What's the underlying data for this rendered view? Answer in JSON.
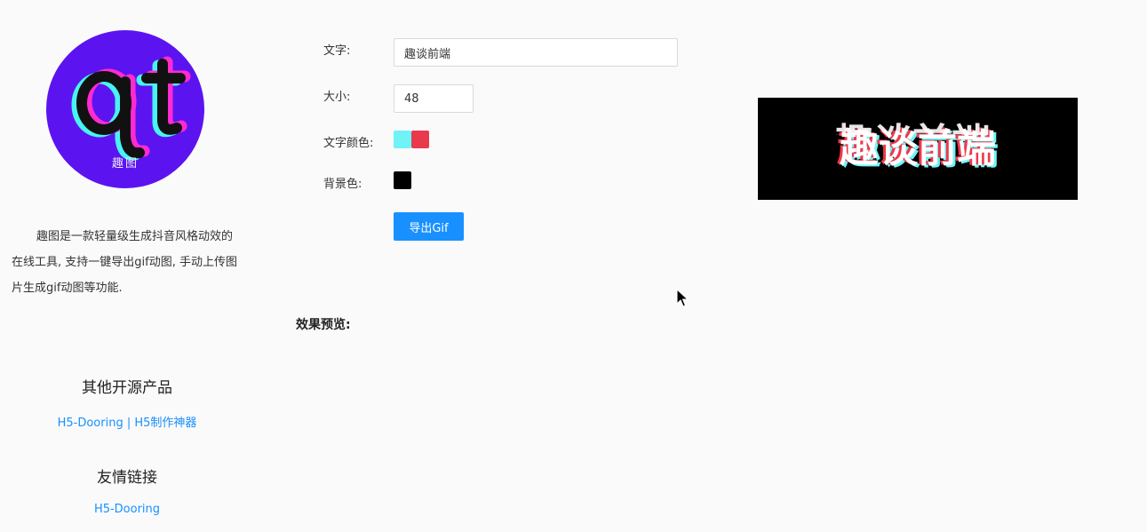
{
  "sidebar": {
    "logo_text": "qt",
    "logo_caption": "趣图",
    "intro": "趣图是一款轻量级生成抖音风格动效的在线工具, 支持一键导出gif动图, 手动上传图片生成gif动图等功能.",
    "other_products_title": "其他开源产品",
    "other_products_link": "H5-Dooring | H5制作神器",
    "friend_links_title": "友情链接",
    "friend_link": "H5-Dooring"
  },
  "form": {
    "text_label": "文字:",
    "text_value": "趣谈前端",
    "size_label": "大小:",
    "size_value": "48",
    "text_color_label": "文字颜色:",
    "text_colors": [
      "#6ff3f7",
      "#e83a4c"
    ],
    "bg_color_label": "背景色:",
    "bg_color": "#000000",
    "export_button": "导出Gif"
  },
  "preview": {
    "label": "效果预览:",
    "text": "趣谈前端",
    "bg_color": "#000000"
  },
  "colors": {
    "accent": "#1890ff",
    "logo_bg": "#5b14f0"
  }
}
